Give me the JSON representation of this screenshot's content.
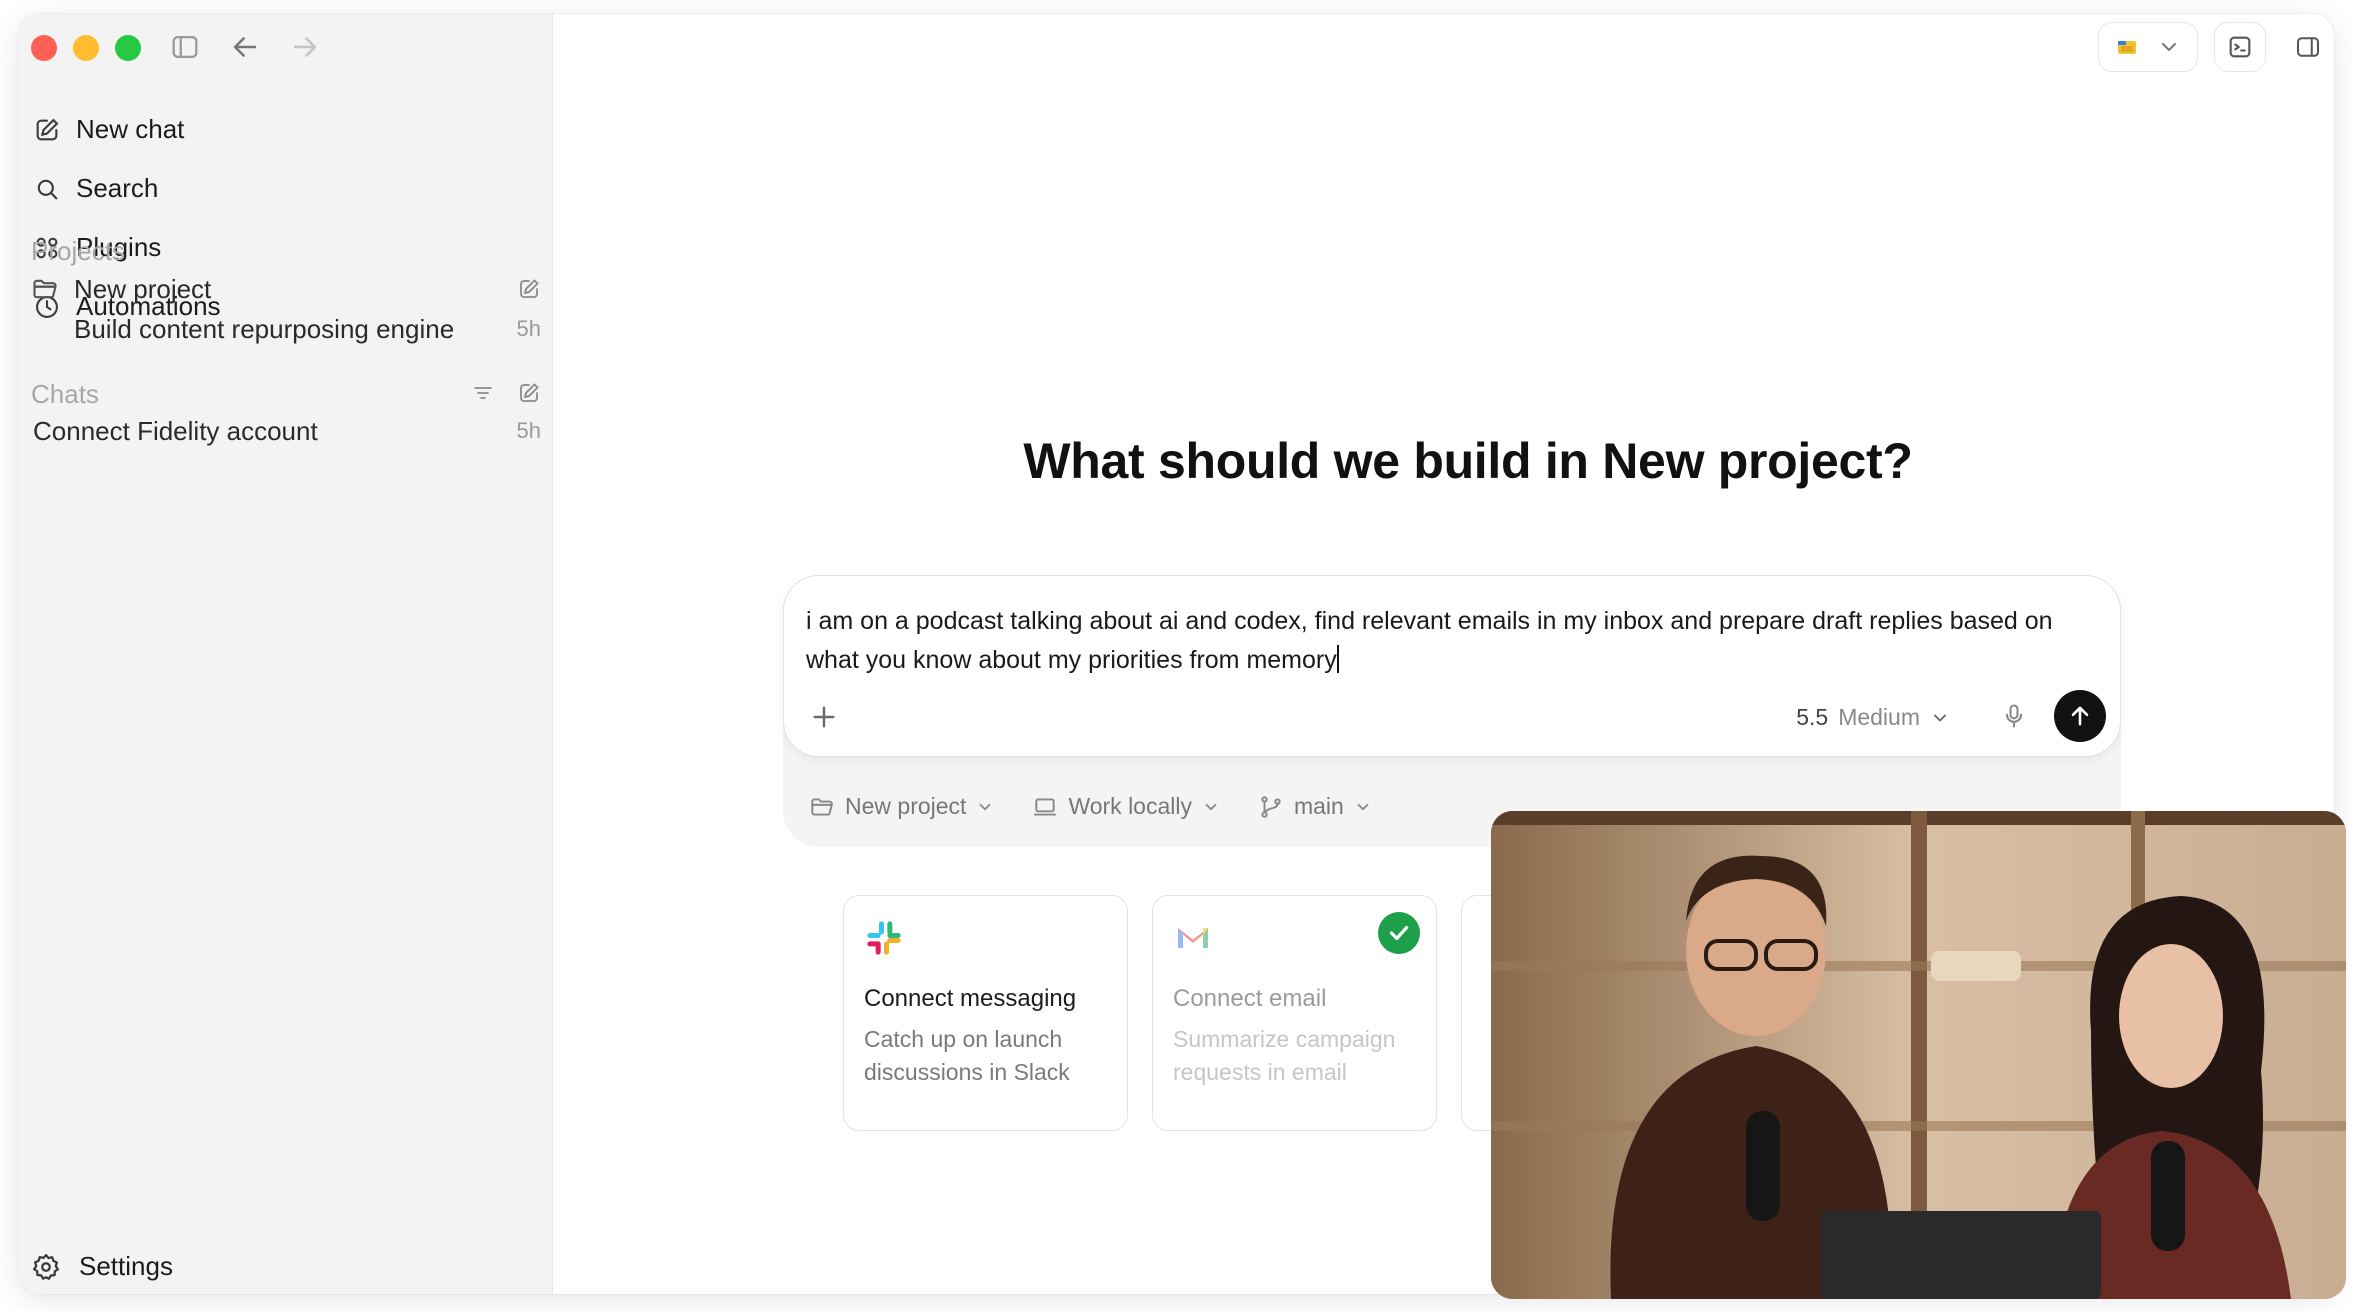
{
  "sidebar": {
    "nav": [
      {
        "label": "New chat",
        "icon": "edit-icon"
      },
      {
        "label": "Search",
        "icon": "search-icon"
      },
      {
        "label": "Plugins",
        "icon": "grid-icon"
      },
      {
        "label": "Automations",
        "icon": "clock-icon"
      }
    ],
    "projects_label": "Projects",
    "project": {
      "label": "New project",
      "icon": "folder-icon"
    },
    "project_thread": {
      "label": "Build content repurposing engine",
      "time": "5h"
    },
    "chats_label": "Chats",
    "chat": {
      "label": "Connect Fidelity account",
      "time": "5h"
    },
    "settings_label": "Settings"
  },
  "main": {
    "heading": "What should we build in New project?",
    "composer": {
      "prompt": "i am on a podcast talking about ai and codex, find relevant emails in my inbox and prepare draft replies based on what you know about my priorities from memory",
      "model_version": "5.5",
      "model_level": "Medium"
    },
    "subbar": {
      "project": "New project",
      "location": "Work locally",
      "branch": "main"
    },
    "cards": [
      {
        "title": "Connect messaging",
        "desc": "Catch up on launch discussions in Slack",
        "icon": "slack-icon"
      },
      {
        "title": "Connect email",
        "desc": "Summarize campaign requests in email",
        "icon": "gmail-icon",
        "connected": true
      }
    ]
  },
  "colors": {
    "accent_dark": "#111111",
    "success": "#1ea04b",
    "sidebar_bg": "#f3f3f3"
  }
}
